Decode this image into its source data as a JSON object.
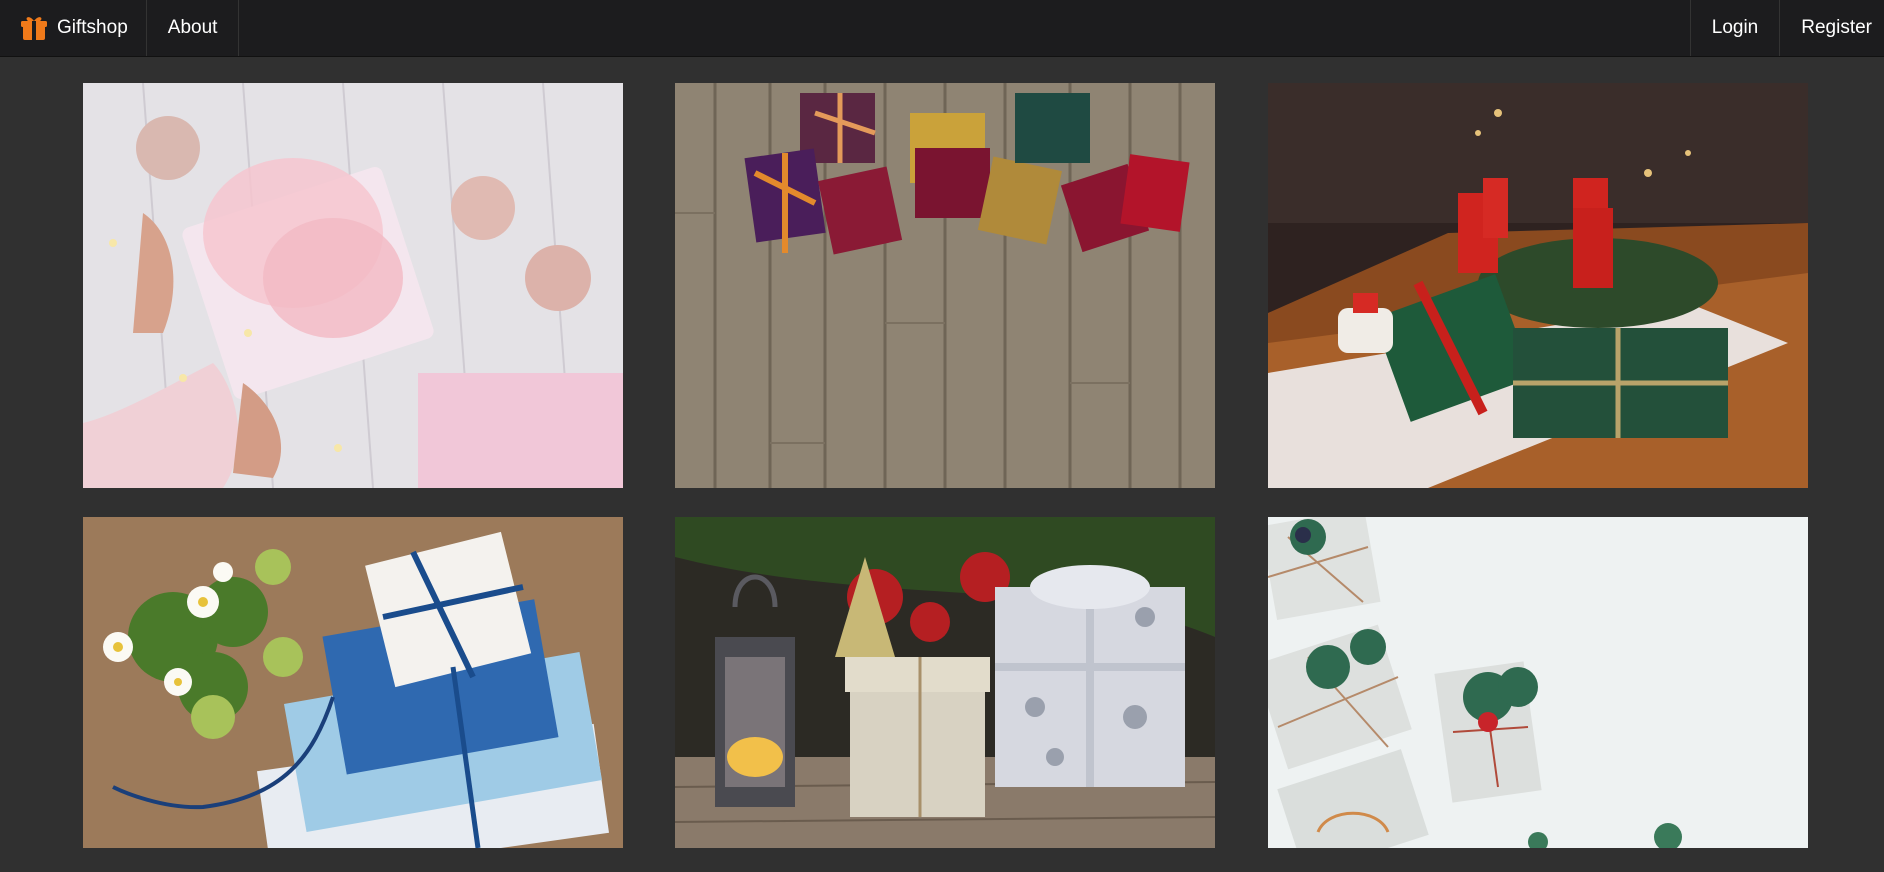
{
  "navbar": {
    "brand_label": "Giftshop",
    "brand_icon": "gift-icon",
    "links": {
      "about": "About",
      "login": "Login",
      "register": "Register"
    }
  },
  "colors": {
    "navbar_bg": "#1c1c1e",
    "page_bg": "#303030",
    "brand_accent": "#f07a1a"
  },
  "gallery": [
    {
      "id": "photo-1",
      "depicts": "hands-holding-pink-gift-with-ornaments"
    },
    {
      "id": "photo-2",
      "depicts": "jewelry-boxes-on-wooden-floor"
    },
    {
      "id": "photo-3",
      "depicts": "advent-wreath-and-green-gifts"
    },
    {
      "id": "photo-4",
      "depicts": "blue-and-white-gift-boxes-with-flowers"
    },
    {
      "id": "photo-5",
      "depicts": "lantern-and-silver-gift-boxes"
    },
    {
      "id": "photo-6",
      "depicts": "white-wrapped-gifts-with-pine-twigs"
    }
  ]
}
